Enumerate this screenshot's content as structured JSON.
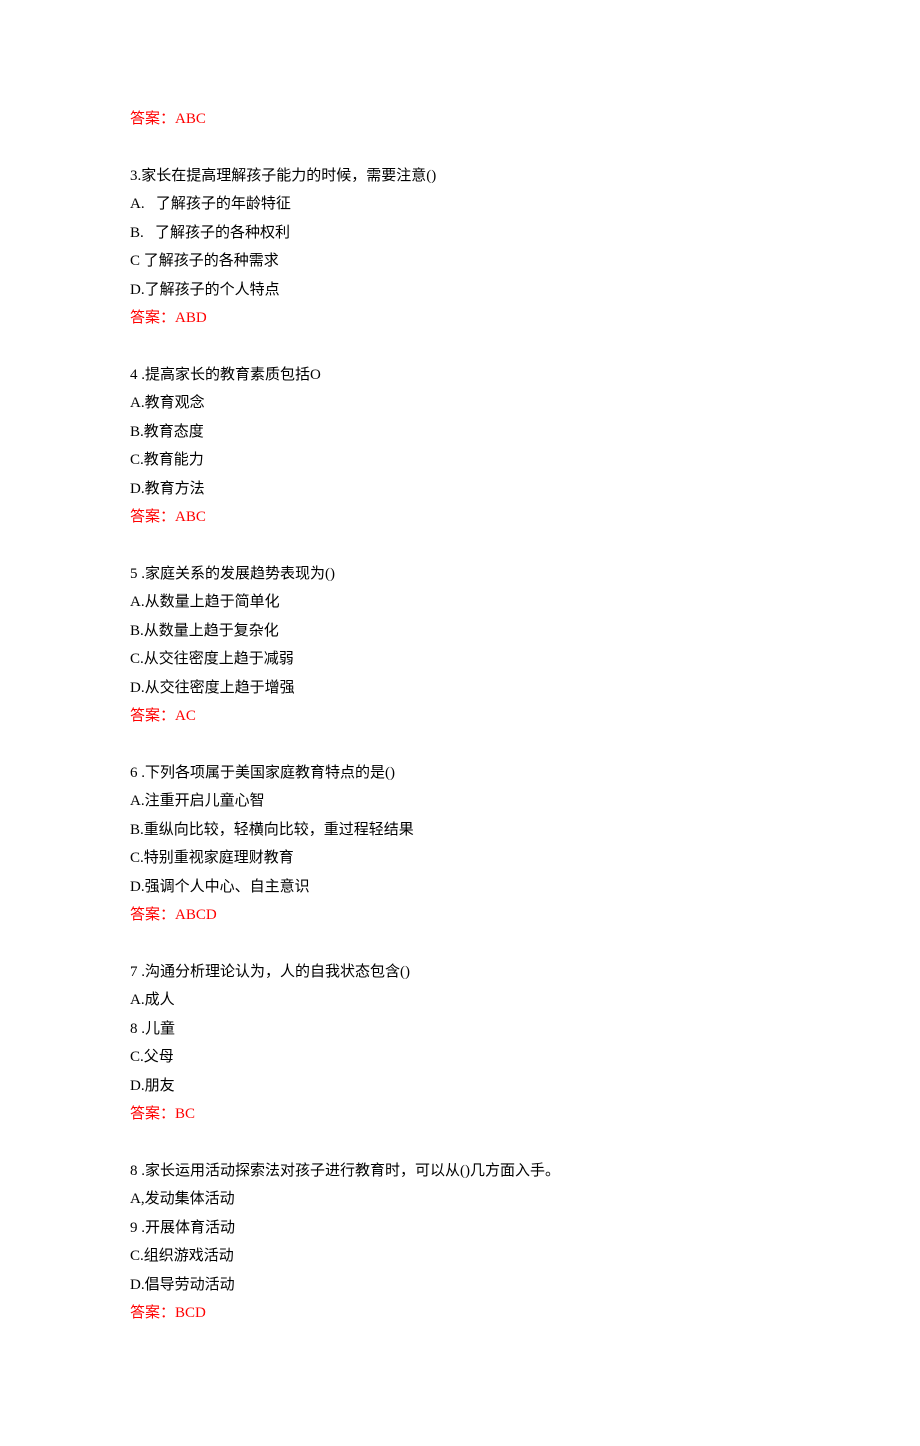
{
  "top_answer": "答案：ABC",
  "questions": [
    {
      "number": "3.",
      "text": "家长在提高理解孩子能力的时候，需要注意()",
      "options": [
        "A.   了解孩子的年龄特征",
        "B.   了解孩子的各种权利",
        "C 了解孩子的各种需求",
        "D.了解孩子的个人特点"
      ],
      "answer": "答案：ABD"
    },
    {
      "number": "4 .",
      "text": "提高家长的教育素质包括O",
      "options": [
        "A.教育观念",
        "B.教育态度",
        "C.教育能力",
        "D.教育方法"
      ],
      "answer": "答案：ABC"
    },
    {
      "number": "5 .",
      "text": "家庭关系的发展趋势表现为()",
      "options": [
        "A.从数量上趋于简单化",
        "B.从数量上趋于复杂化",
        "C.从交往密度上趋于减弱",
        "D.从交往密度上趋于增强"
      ],
      "answer": "答案：AC"
    },
    {
      "number": "6 .",
      "text": "下列各项属于美国家庭教育特点的是()",
      "options": [
        "A.注重开启儿童心智",
        "B.重纵向比较，轻横向比较，重过程轻结果",
        "C.特别重视家庭理财教育",
        "D.强调个人中心、自主意识"
      ],
      "answer": "答案：ABCD"
    },
    {
      "number": "7 .",
      "text": "沟通分析理论认为，人的自我状态包含()",
      "options": [
        "A.成人",
        "8 .儿童",
        "C.父母",
        "D.朋友"
      ],
      "answer": "答案：BC"
    },
    {
      "number": "8 .",
      "text": "家长运用活动探索法对孩子进行教育时，可以从()几方面入手。",
      "options": [
        "A,发动集体活动",
        "9 .开展体育活动",
        "C.组织游戏活动",
        "D.倡导劳动活动"
      ],
      "answer": "答案：BCD"
    }
  ]
}
